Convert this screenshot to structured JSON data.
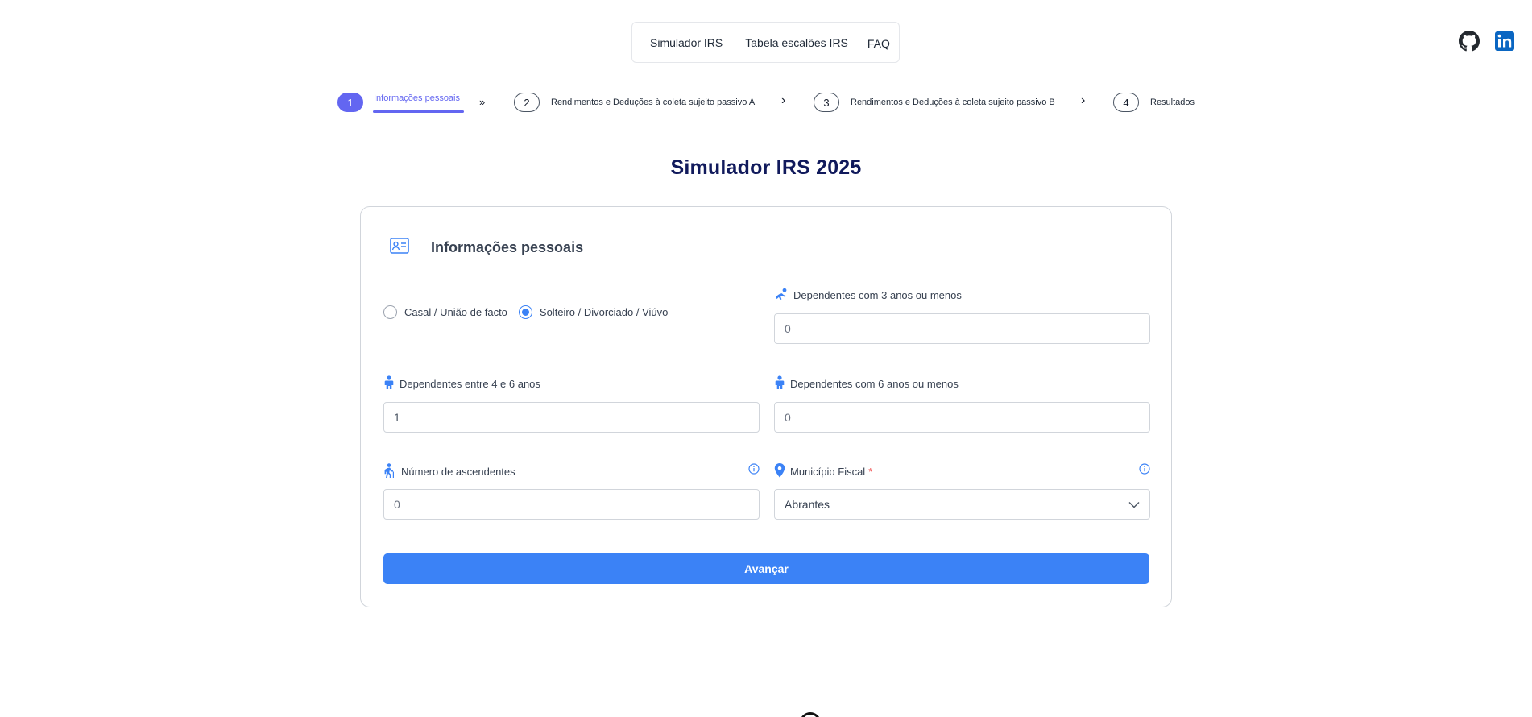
{
  "nav": {
    "items": [
      "Simulador IRS",
      "Tabela escalões IRS",
      "FAQ"
    ]
  },
  "social": {
    "github": "github-icon",
    "linkedin": "linkedin-icon"
  },
  "stepper": {
    "steps": [
      {
        "number": "1",
        "label": "Informações pessoais",
        "active": true
      },
      {
        "number": "2",
        "label": "Rendimentos e Deduções à coleta sujeito passivo A",
        "active": false
      },
      {
        "number": "3",
        "label": "Rendimentos e Deduções à coleta sujeito passivo B",
        "active": false
      },
      {
        "number": "4",
        "label": "Resultados",
        "active": false
      }
    ],
    "separators": [
      "»",
      "›",
      "›"
    ]
  },
  "page": {
    "title": "Simulador IRS 2025"
  },
  "form": {
    "title": "Informações pessoais",
    "civil_status": {
      "options": [
        "Casal / União de facto",
        "Solteiro / Divorciado / Viúvo"
      ],
      "selected": "Solteiro / Divorciado / Viúvo"
    },
    "dependents_3_or_less": {
      "label": "Dependentes com 3 anos ou menos",
      "value": "0"
    },
    "dependents_4_to_6": {
      "label": "Dependentes entre 4 e 6 anos",
      "value": "1"
    },
    "dependents_6_or_less": {
      "label": "Dependentes com 6 anos ou menos",
      "value": "0"
    },
    "ascendants": {
      "label": "Número de ascendentes",
      "value": "0"
    },
    "municipality": {
      "label": "Município Fiscal",
      "required_mark": "*",
      "value": "Abrantes"
    },
    "submit_label": "Avançar"
  },
  "colors": {
    "accent": "#6366f1",
    "primary_button": "#3b82f6",
    "title": "#111a5c",
    "required": "#ef4444",
    "linkedin": "#0a66c2"
  }
}
